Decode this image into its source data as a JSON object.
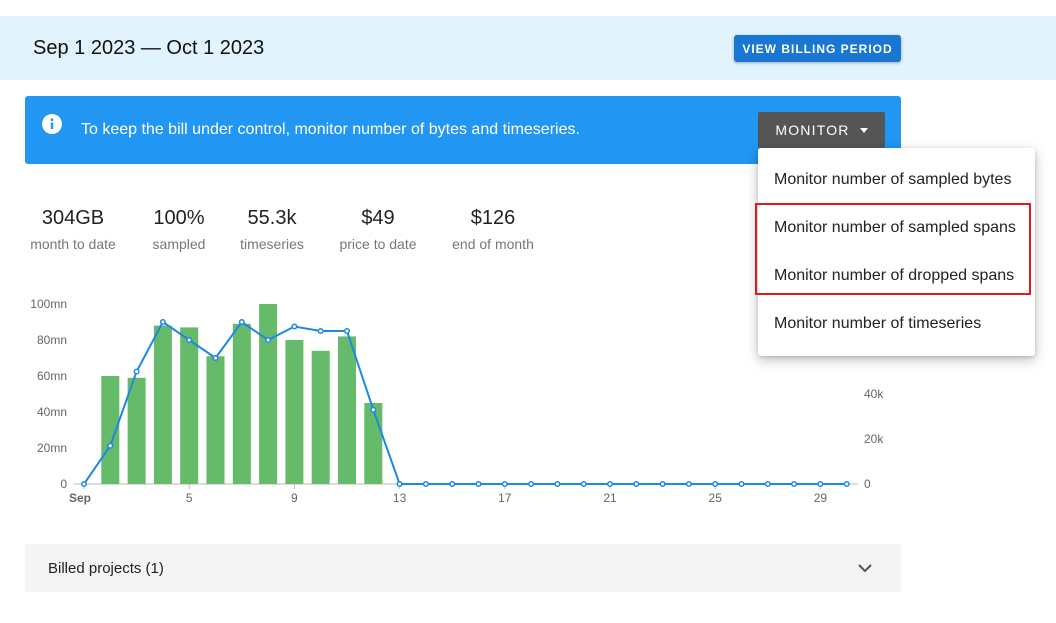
{
  "header": {
    "period": "Sep 1 2023 — Oct 1 2023",
    "view_button": "VIEW BILLING PERIOD"
  },
  "banner": {
    "icon": "info-icon",
    "text": "To keep the bill under control, monitor number of bytes and timeseries.",
    "monitor_button": "MONITOR"
  },
  "stats": [
    {
      "value": "304GB",
      "label": "month to date"
    },
    {
      "value": "100%",
      "label": "sampled"
    },
    {
      "value": "55.3k",
      "label": "timeseries"
    },
    {
      "value": "$49",
      "label": "price to date"
    },
    {
      "value": "$126",
      "label": "end of month"
    }
  ],
  "monitor_menu": {
    "items": [
      "Monitor number of sampled bytes",
      "Monitor number of sampled spans",
      "Monitor number of dropped spans",
      "Monitor number of timeseries"
    ],
    "highlighted": [
      1,
      2
    ],
    "highlight_color": "#e41a1a"
  },
  "chart_data": {
    "type": "bar",
    "x": [
      1,
      2,
      3,
      4,
      5,
      6,
      7,
      8,
      9,
      10,
      11,
      12,
      13,
      14,
      15,
      16,
      17,
      18,
      19,
      20,
      21,
      22,
      23,
      24,
      25,
      26,
      27,
      28,
      29,
      30
    ],
    "x_ticks": [
      {
        "x": 1,
        "label": "Sep"
      },
      {
        "x": 5,
        "label": "5"
      },
      {
        "x": 9,
        "label": "9"
      },
      {
        "x": 13,
        "label": "13"
      },
      {
        "x": 17,
        "label": "17"
      },
      {
        "x": 21,
        "label": "21"
      },
      {
        "x": 25,
        "label": "25"
      },
      {
        "x": 29,
        "label": "29"
      }
    ],
    "y_left_ticks": [
      "0",
      "20mn",
      "40mn",
      "60mn",
      "80mn",
      "100mn"
    ],
    "y_left_range": [
      0,
      100
    ],
    "y_right_ticks_visible": [
      "0",
      "20k",
      "40k"
    ],
    "y_right_range": [
      0,
      80
    ],
    "series": [
      {
        "kind": "bar",
        "axis": "left",
        "color": "#66bb6a",
        "values": [
          0,
          60,
          59,
          88,
          87,
          71,
          89,
          100,
          80,
          74,
          82,
          45,
          0,
          0,
          0,
          0,
          0,
          0,
          0,
          0,
          0,
          0,
          0,
          0,
          0,
          0,
          0,
          0,
          0,
          0
        ]
      },
      {
        "kind": "line",
        "axis": "right",
        "color": "#1e88e5",
        "values": [
          0,
          17,
          50,
          72,
          64,
          56,
          72,
          64,
          70,
          68,
          68,
          33,
          0,
          0,
          0,
          0,
          0,
          0,
          0,
          0,
          0,
          0,
          0,
          0,
          0,
          0,
          0,
          0,
          0,
          0
        ]
      }
    ]
  },
  "projects": {
    "label": "Billed projects (1)",
    "icon": "chevron-down-icon"
  }
}
